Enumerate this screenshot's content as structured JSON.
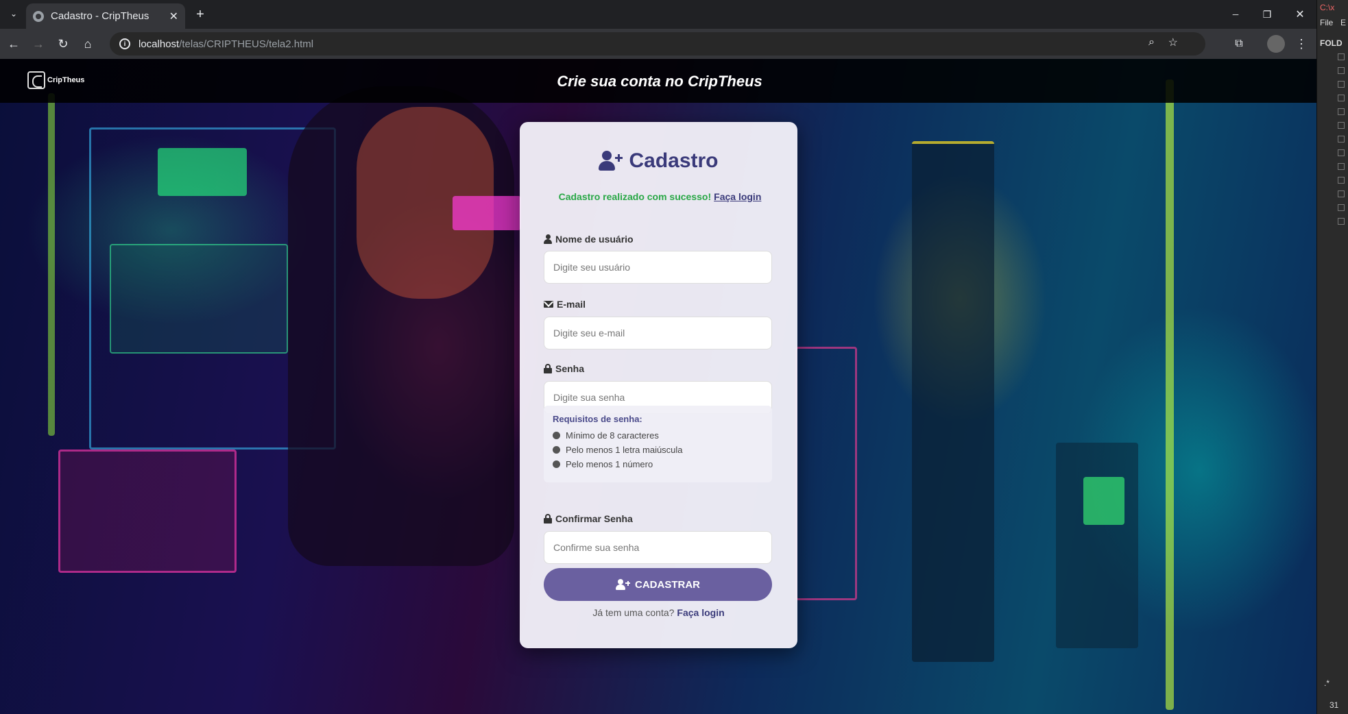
{
  "browser": {
    "tab_title": "Cadastro - CripTheus",
    "new_tab": "+",
    "url_host": "localhost",
    "url_path": "/telas/CRIPTHEUS/tela2.html",
    "window_buttons": {
      "minimize": "─",
      "restore": "❐",
      "close": "✕"
    }
  },
  "sidepanel": {
    "title": "C:\\x",
    "menu_file": "File",
    "menu_e": "E",
    "folders": "FOLD",
    "status": "31",
    "regex": ".*"
  },
  "header": {
    "logo_text": "CripTheus",
    "heading": "Crie sua conta no CripTheus"
  },
  "form": {
    "title": "Cadastro",
    "success_message": "Cadastro realizado com sucesso!",
    "success_link": "Faça login",
    "username": {
      "label": "Nome de usuário",
      "placeholder": "Digite seu usuário",
      "value": ""
    },
    "email": {
      "label": "E-mail",
      "placeholder": "Digite seu e-mail",
      "value": ""
    },
    "password": {
      "label": "Senha",
      "placeholder": "Digite sua senha",
      "value": ""
    },
    "requirements": {
      "title": "Requisitos de senha:",
      "items": [
        "Mínimo de 8 caracteres",
        "Pelo menos 1 letra maiúscula",
        "Pelo menos 1 número"
      ]
    },
    "confirm": {
      "label": "Confirmar Senha",
      "placeholder": "Confirme sua senha",
      "value": ""
    },
    "submit_label": "CADASTRAR",
    "footer_text": "Já tem uma conta?",
    "footer_link": "Faça login"
  },
  "colors": {
    "accent": "#6a60a0",
    "title": "#3a3a7a",
    "success": "#28a745"
  }
}
